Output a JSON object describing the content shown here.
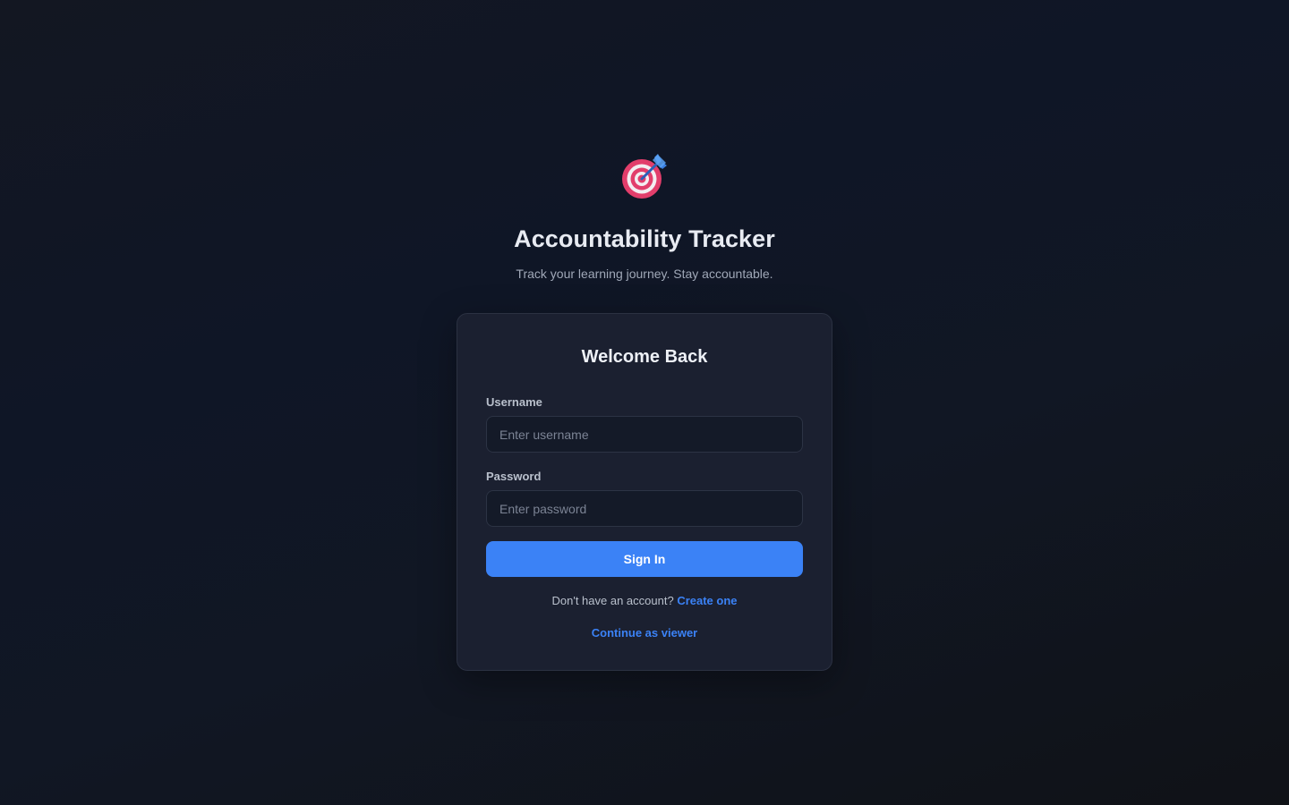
{
  "app": {
    "title": "Accountability Tracker",
    "subtitle": "Track your learning journey. Stay accountable.",
    "logo_icon": "target-dart-icon"
  },
  "login_card": {
    "title": "Welcome Back",
    "username": {
      "label": "Username",
      "placeholder": "Enter username",
      "value": ""
    },
    "password": {
      "label": "Password",
      "placeholder": "Enter password",
      "value": ""
    },
    "submit_label": "Sign In",
    "signup_prompt": "Don't have an account?",
    "signup_link": "Create one",
    "viewer_link": "Continue as viewer"
  },
  "colors": {
    "accent": "#3b82f6",
    "card_bg": "#1b2030",
    "page_bg": "#111724",
    "target_red": "#e23e6b",
    "dart_blue": "#4f95ef"
  }
}
